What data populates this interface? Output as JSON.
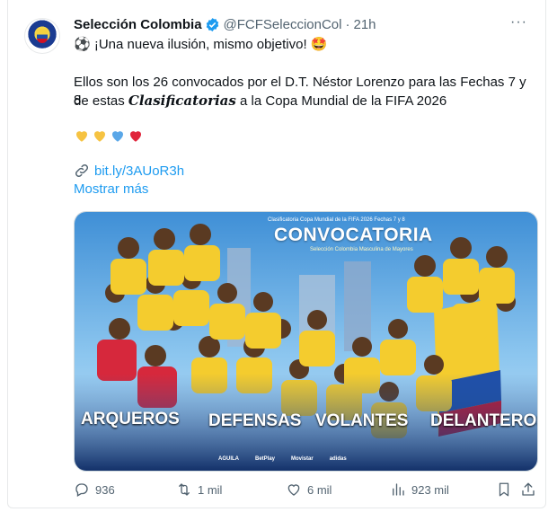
{
  "tweet": {
    "display_name": "Selección Colombia",
    "handle": "@FCFSeleccionCol",
    "dot": "·",
    "time": "21h",
    "headline": "⚽ ¡Una nueva ilusión, mismo objetivo! 🤩",
    "body_line1": "Ellos son los 26 convocados por el D.T. Néstor Lorenzo para las Fechas 7 y 8",
    "body_line2_pre": "de estas ",
    "body_line2_em": "Clasificatorias",
    "body_line2_post": " a la Copa Mundial de la FIFA 2026",
    "link": "bit.ly/3AUoR3h",
    "show_more": "Mostrar más",
    "more_menu": "···"
  },
  "hearts": [
    {
      "name": "yellow-heart-icon",
      "color": "#f6c342"
    },
    {
      "name": "yellow-heart-icon",
      "color": "#f6c342"
    },
    {
      "name": "blue-heart-icon",
      "color": "#5aa7e8"
    },
    {
      "name": "red-heart-icon",
      "color": "#e0243b"
    }
  ],
  "media": {
    "top_caption": "Clasificatoria Copa Mundial de la FIFA 2026 Fechas 7 y 8",
    "title": "CONVOCATORIA",
    "subtitle": "Selección Colombia Masculina de Mayores",
    "categories": [
      "ARQUEROS",
      "DEFENSAS",
      "VOLANTES",
      "DELANTEROS"
    ],
    "sponsors": [
      "AGUILA",
      "BetPlay",
      "Movistar",
      "adidas"
    ]
  },
  "stats": {
    "replies": "936",
    "retweets": "1 mil",
    "likes": "6 mil",
    "views": "923 mil"
  },
  "colors": {
    "accent": "#1d9bf0",
    "secondary_text": "#536471",
    "jersey_yellow": "#f4cc2e",
    "sky_blue": "#4fa3e0"
  }
}
